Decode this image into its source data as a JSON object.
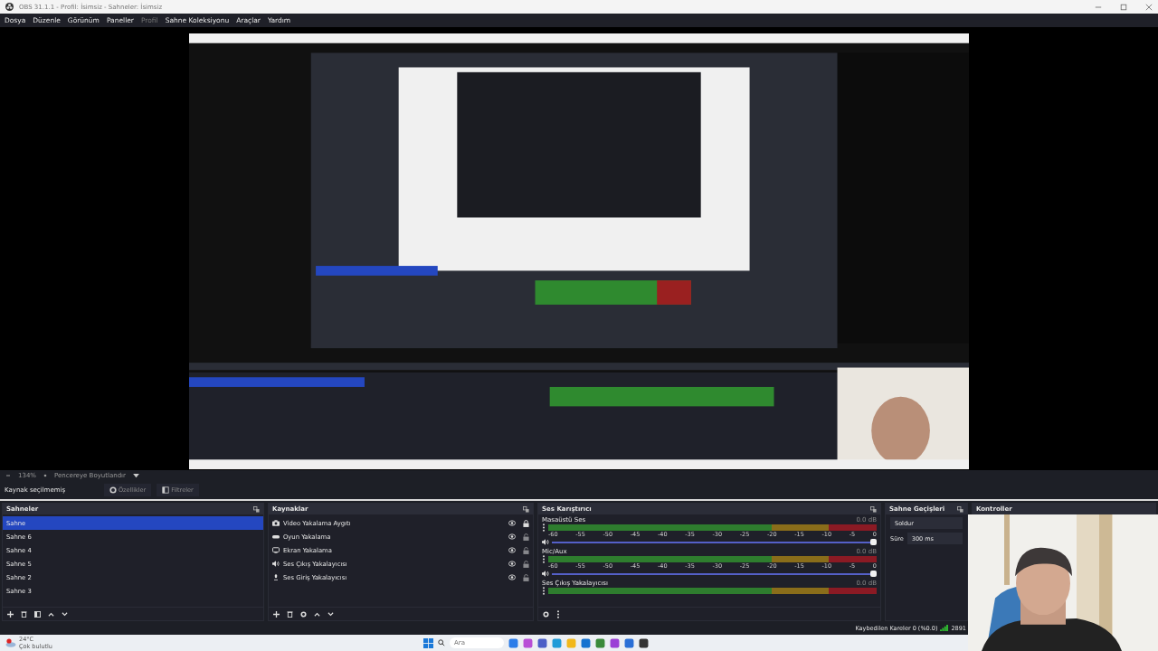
{
  "window": {
    "title": "OBS 31.1.1 - Profil: İsimsiz - Sahneler: İsimsiz"
  },
  "menu": [
    {
      "label": "Dosya",
      "disabled": false
    },
    {
      "label": "Düzenle",
      "disabled": false
    },
    {
      "label": "Görünüm",
      "disabled": false
    },
    {
      "label": "Paneller",
      "disabled": false
    },
    {
      "label": "Profil",
      "disabled": true
    },
    {
      "label": "Sahne Koleksiyonu",
      "disabled": false
    },
    {
      "label": "Araçlar",
      "disabled": false
    },
    {
      "label": "Yardım",
      "disabled": false
    }
  ],
  "zoom_bar": {
    "zoom": "134%",
    "fit_mode": "Pencereye Boyutlandır"
  },
  "context_bar": {
    "status": "Kaynak seçilmemiş",
    "buttons": [
      "Özellikler",
      "Filtreler"
    ]
  },
  "scenes": {
    "title": "Sahneler",
    "items": [
      {
        "label": "Sahne",
        "selected": true
      },
      {
        "label": "Sahne 6",
        "selected": false
      },
      {
        "label": "Sahne 4",
        "selected": false
      },
      {
        "label": "Sahne 5",
        "selected": false
      },
      {
        "label": "Sahne 2",
        "selected": false
      },
      {
        "label": "Sahne 3",
        "selected": false
      }
    ]
  },
  "sources": {
    "title": "Kaynaklar",
    "items": [
      {
        "label": "Video Yakalama Aygıtı",
        "kind": "camera",
        "visible": true,
        "locked": true
      },
      {
        "label": "Oyun Yakalama",
        "kind": "gamepad",
        "visible": true,
        "locked": false
      },
      {
        "label": "Ekran Yakalama",
        "kind": "monitor",
        "visible": true,
        "locked": false
      },
      {
        "label": "Ses Çıkış Yakalayıcısı",
        "kind": "speaker",
        "visible": true,
        "locked": false
      },
      {
        "label": "Ses Giriş Yakalayıcısı",
        "kind": "mic",
        "visible": true,
        "locked": false
      }
    ]
  },
  "mixer": {
    "title": "Ses Karıştırıcı",
    "channels": [
      {
        "name": "Masaüstü Ses",
        "reading": "0.0 dB",
        "scale": [
          "-60",
          "-55",
          "-50",
          "-45",
          "-40",
          "-35",
          "-30",
          "-25",
          "-20",
          "-15",
          "-10",
          "-5",
          "0"
        ],
        "level": 1
      },
      {
        "name": "Mic/Aux",
        "reading": "0.0 dB",
        "scale": [
          "-60",
          "-55",
          "-50",
          "-45",
          "-40",
          "-35",
          "-30",
          "-25",
          "-20",
          "-15",
          "-10",
          "-5",
          "0"
        ],
        "level": 1
      },
      {
        "name": "Ses Çıkış Yakalayıcısı",
        "reading": "0.0 dB"
      }
    ]
  },
  "transitions": {
    "title": "Sahne Geçişleri",
    "type": "Soldur",
    "duration_label": "Süre",
    "duration": "300 ms"
  },
  "controls": {
    "title": "Kontroller"
  },
  "status_bar": {
    "dropped_frames": "Kaybedilen Kareler 0 (%0.0)",
    "bitrate": "2891"
  },
  "taskbar": {
    "weather": {
      "temperature": "24°C",
      "condition": "Çok bulutlu"
    },
    "search": {
      "placeholder": "Ara"
    }
  }
}
